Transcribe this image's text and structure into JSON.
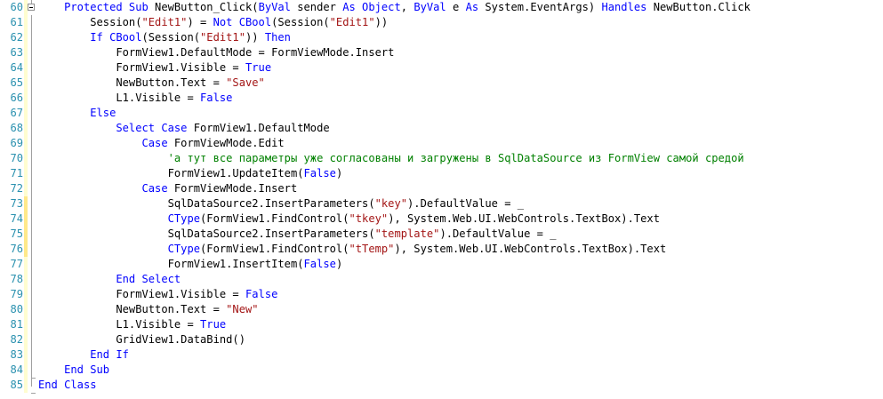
{
  "editor": {
    "lines": [
      {
        "num": "60",
        "changed": false,
        "segs": [
          {
            "k": "p",
            "t": "    "
          },
          {
            "k": "kw",
            "t": "Protected Sub"
          },
          {
            "k": "p",
            "t": " NewButton_Click("
          },
          {
            "k": "kw",
            "t": "ByVal"
          },
          {
            "k": "p",
            "t": " sender "
          },
          {
            "k": "kw",
            "t": "As Object"
          },
          {
            "k": "p",
            "t": ", "
          },
          {
            "k": "kw",
            "t": "ByVal"
          },
          {
            "k": "p",
            "t": " e "
          },
          {
            "k": "kw",
            "t": "As"
          },
          {
            "k": "p",
            "t": " System.EventArgs) "
          },
          {
            "k": "kw",
            "t": "Handles"
          },
          {
            "k": "p",
            "t": " NewButton.Click"
          }
        ]
      },
      {
        "num": "61",
        "changed": false,
        "segs": [
          {
            "k": "p",
            "t": "        Session("
          },
          {
            "k": "str",
            "t": "\"Edit1\""
          },
          {
            "k": "p",
            "t": ") = "
          },
          {
            "k": "kw",
            "t": "Not"
          },
          {
            "k": "p",
            "t": " "
          },
          {
            "k": "kw",
            "t": "CBool"
          },
          {
            "k": "p",
            "t": "(Session("
          },
          {
            "k": "str",
            "t": "\"Edit1\""
          },
          {
            "k": "p",
            "t": "))"
          }
        ]
      },
      {
        "num": "62",
        "changed": false,
        "segs": [
          {
            "k": "p",
            "t": "        "
          },
          {
            "k": "kw",
            "t": "If CBool"
          },
          {
            "k": "p",
            "t": "(Session("
          },
          {
            "k": "str",
            "t": "\"Edit1\""
          },
          {
            "k": "p",
            "t": ")) "
          },
          {
            "k": "kw",
            "t": "Then"
          }
        ]
      },
      {
        "num": "63",
        "changed": false,
        "segs": [
          {
            "k": "p",
            "t": "            FormView1.DefaultMode = FormViewMode.Insert"
          }
        ]
      },
      {
        "num": "64",
        "changed": false,
        "segs": [
          {
            "k": "p",
            "t": "            FormView1.Visible = "
          },
          {
            "k": "kw",
            "t": "True"
          }
        ]
      },
      {
        "num": "65",
        "changed": false,
        "segs": [
          {
            "k": "p",
            "t": "            NewButton.Text = "
          },
          {
            "k": "str",
            "t": "\"Save\""
          }
        ]
      },
      {
        "num": "66",
        "changed": false,
        "segs": [
          {
            "k": "p",
            "t": "            L1.Visible = "
          },
          {
            "k": "kw",
            "t": "False"
          }
        ]
      },
      {
        "num": "67",
        "changed": false,
        "segs": [
          {
            "k": "p",
            "t": "        "
          },
          {
            "k": "kw",
            "t": "Else"
          }
        ]
      },
      {
        "num": "68",
        "changed": false,
        "segs": [
          {
            "k": "p",
            "t": "            "
          },
          {
            "k": "kw",
            "t": "Select Case"
          },
          {
            "k": "p",
            "t": " FormView1.DefaultMode"
          }
        ]
      },
      {
        "num": "69",
        "changed": false,
        "segs": [
          {
            "k": "p",
            "t": "                "
          },
          {
            "k": "kw",
            "t": "Case"
          },
          {
            "k": "p",
            "t": " FormViewMode.Edit"
          }
        ]
      },
      {
        "num": "70",
        "changed": false,
        "segs": [
          {
            "k": "p",
            "t": "                    "
          },
          {
            "k": "cm",
            "t": "'а тут все параметры уже согласованы и загружены в SqlDataSource из FormView самой средой"
          }
        ]
      },
      {
        "num": "71",
        "changed": false,
        "segs": [
          {
            "k": "p",
            "t": "                    FormView1.UpdateItem("
          },
          {
            "k": "kw",
            "t": "False"
          },
          {
            "k": "p",
            "t": ")"
          }
        ]
      },
      {
        "num": "72",
        "changed": false,
        "segs": [
          {
            "k": "p",
            "t": "                "
          },
          {
            "k": "kw",
            "t": "Case"
          },
          {
            "k": "p",
            "t": " FormViewMode.Insert"
          }
        ]
      },
      {
        "num": "73",
        "changed": true,
        "segs": [
          {
            "k": "p",
            "t": "                    SqlDataSource2.InsertParameters("
          },
          {
            "k": "str",
            "t": "\"key\""
          },
          {
            "k": "p",
            "t": ").DefaultValue = _"
          }
        ]
      },
      {
        "num": "74",
        "changed": true,
        "segs": [
          {
            "k": "p",
            "t": "                    "
          },
          {
            "k": "kw",
            "t": "CType"
          },
          {
            "k": "p",
            "t": "(FormView1.FindControl("
          },
          {
            "k": "str",
            "t": "\"tkey\""
          },
          {
            "k": "p",
            "t": "), System.Web.UI.WebControls.TextBox).Text"
          }
        ]
      },
      {
        "num": "75",
        "changed": true,
        "segs": [
          {
            "k": "p",
            "t": "                    SqlDataSource2.InsertParameters("
          },
          {
            "k": "str",
            "t": "\"template\""
          },
          {
            "k": "p",
            "t": ").DefaultValue = _"
          }
        ]
      },
      {
        "num": "76",
        "changed": true,
        "segs": [
          {
            "k": "p",
            "t": "                    "
          },
          {
            "k": "kw",
            "t": "CType"
          },
          {
            "k": "p",
            "t": "(FormView1.FindControl("
          },
          {
            "k": "str",
            "t": "\"tTemp\""
          },
          {
            "k": "p",
            "t": "), System.Web.UI.WebControls.TextBox).Text"
          }
        ]
      },
      {
        "num": "77",
        "changed": false,
        "segs": [
          {
            "k": "p",
            "t": "                    FormView1.InsertItem("
          },
          {
            "k": "kw",
            "t": "False"
          },
          {
            "k": "p",
            "t": ")"
          }
        ]
      },
      {
        "num": "78",
        "changed": false,
        "segs": [
          {
            "k": "p",
            "t": "            "
          },
          {
            "k": "kw",
            "t": "End Select"
          }
        ]
      },
      {
        "num": "79",
        "changed": false,
        "segs": [
          {
            "k": "p",
            "t": "            FormView1.Visible = "
          },
          {
            "k": "kw",
            "t": "False"
          }
        ]
      },
      {
        "num": "80",
        "changed": false,
        "segs": [
          {
            "k": "p",
            "t": "            NewButton.Text = "
          },
          {
            "k": "str",
            "t": "\"New\""
          }
        ]
      },
      {
        "num": "81",
        "changed": false,
        "segs": [
          {
            "k": "p",
            "t": "            L1.Visible = "
          },
          {
            "k": "kw",
            "t": "True"
          }
        ]
      },
      {
        "num": "82",
        "changed": false,
        "segs": [
          {
            "k": "p",
            "t": "            GridView1.DataBind()"
          }
        ]
      },
      {
        "num": "83",
        "changed": false,
        "segs": [
          {
            "k": "p",
            "t": "        "
          },
          {
            "k": "kw",
            "t": "End If"
          }
        ]
      },
      {
        "num": "84",
        "changed": false,
        "segs": [
          {
            "k": "p",
            "t": "    "
          },
          {
            "k": "kw",
            "t": "End Sub"
          }
        ]
      },
      {
        "num": "85",
        "changed": false,
        "segs": [
          {
            "k": "kw",
            "t": "End Class"
          }
        ]
      }
    ]
  }
}
